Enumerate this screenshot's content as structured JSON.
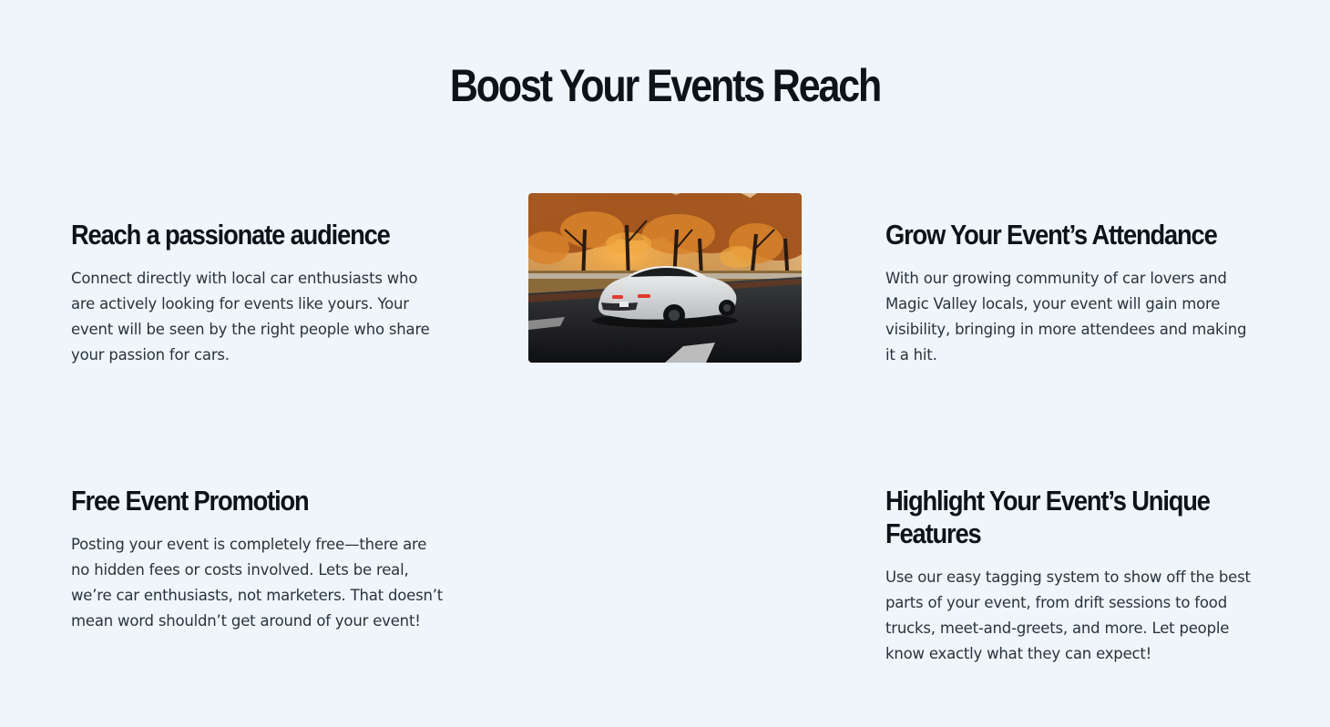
{
  "page": {
    "title": "Boost Your Events Reach",
    "background_color": "#eef5fb",
    "text_color": "#0d1419"
  },
  "features": [
    {
      "heading": "Reach a passionate audience",
      "body": "Connect directly with local car enthusiasts who are actively looking for events like yours. Your event will be seen by the right people who share your passion for cars."
    },
    {
      "heading": "Grow Your Event’s Attendance",
      "body": "With our growing community of car lovers and Magic Valley locals, your event will gain more visibility, bringing in more attendees and making it a hit."
    },
    {
      "heading": "Free Event Promotion",
      "body": "Posting your event is completely free—there are no hidden fees or costs involved. Lets be real, we’re car enthusiasts, not marketers. That doesn’t mean word shouldn’t get around of your event!"
    },
    {
      "heading": "Highlight Your Event’s Unique Features",
      "body": "Use our easy tagging system to show off the best parts of your event, from drift sessions to food trucks, meet-and-greets, and more. Let people know exactly what they can expect!"
    }
  ],
  "image": {
    "icon": "car-photo"
  }
}
